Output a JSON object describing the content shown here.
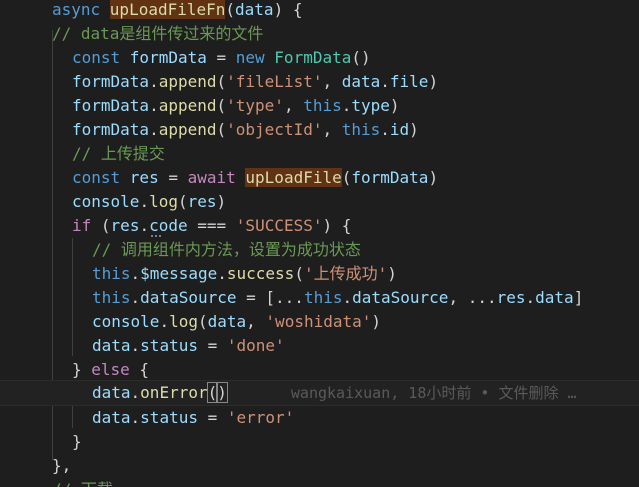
{
  "editor": {
    "lines": [
      [
        {
          "t": "async ",
          "c": "kw"
        },
        {
          "t": "upLoadFileFn",
          "c": "fn hl"
        },
        {
          "t": "(",
          "c": "pun"
        },
        {
          "t": "data",
          "c": "var"
        },
        {
          "t": ") {",
          "c": "pun"
        }
      ],
      [
        {
          "t": "// data是组件传过来的文件",
          "c": "cmt"
        }
      ],
      [
        {
          "t": "const ",
          "c": "kw"
        },
        {
          "t": "formData",
          "c": "var"
        },
        {
          "t": " = ",
          "c": "pun"
        },
        {
          "t": "new ",
          "c": "kw"
        },
        {
          "t": "FormData",
          "c": "cls"
        },
        {
          "t": "()",
          "c": "pun"
        }
      ],
      [
        {
          "t": "formData",
          "c": "var"
        },
        {
          "t": ".",
          "c": "pun"
        },
        {
          "t": "append",
          "c": "fn"
        },
        {
          "t": "(",
          "c": "pun"
        },
        {
          "t": "'fileList'",
          "c": "str"
        },
        {
          "t": ", ",
          "c": "pun"
        },
        {
          "t": "data",
          "c": "var"
        },
        {
          "t": ".",
          "c": "pun"
        },
        {
          "t": "file",
          "c": "var"
        },
        {
          "t": ")",
          "c": "pun"
        }
      ],
      [
        {
          "t": "formData",
          "c": "var"
        },
        {
          "t": ".",
          "c": "pun"
        },
        {
          "t": "append",
          "c": "fn"
        },
        {
          "t": "(",
          "c": "pun"
        },
        {
          "t": "'type'",
          "c": "str"
        },
        {
          "t": ", ",
          "c": "pun"
        },
        {
          "t": "this",
          "c": "kw"
        },
        {
          "t": ".",
          "c": "pun"
        },
        {
          "t": "type",
          "c": "var"
        },
        {
          "t": ")",
          "c": "pun"
        }
      ],
      [
        {
          "t": "formData",
          "c": "var"
        },
        {
          "t": ".",
          "c": "pun"
        },
        {
          "t": "append",
          "c": "fn"
        },
        {
          "t": "(",
          "c": "pun"
        },
        {
          "t": "'objectId'",
          "c": "str"
        },
        {
          "t": ", ",
          "c": "pun"
        },
        {
          "t": "this",
          "c": "kw"
        },
        {
          "t": ".",
          "c": "pun"
        },
        {
          "t": "id",
          "c": "var"
        },
        {
          "t": ")",
          "c": "pun"
        }
      ],
      [
        {
          "t": "// 上传提交",
          "c": "cmt"
        }
      ],
      [
        {
          "t": "const ",
          "c": "kw"
        },
        {
          "t": "res",
          "c": "var"
        },
        {
          "t": " = ",
          "c": "pun"
        },
        {
          "t": "await ",
          "c": "ctl"
        },
        {
          "t": "upLoadFile",
          "c": "fn hl"
        },
        {
          "t": "(",
          "c": "pun"
        },
        {
          "t": "formData",
          "c": "var"
        },
        {
          "t": ")",
          "c": "pun"
        }
      ],
      [
        {
          "t": "console",
          "c": "var"
        },
        {
          "t": ".",
          "c": "pun"
        },
        {
          "t": "log",
          "c": "fn"
        },
        {
          "t": "(",
          "c": "pun"
        },
        {
          "t": "res",
          "c": "var"
        },
        {
          "t": ")",
          "c": "pun"
        }
      ],
      [
        {
          "t": "if ",
          "c": "ctl"
        },
        {
          "t": "(",
          "c": "pun"
        },
        {
          "t": "res",
          "c": "var"
        },
        {
          "t": ".",
          "c": "pun"
        },
        {
          "t": "code",
          "c": "var"
        },
        {
          "t": " === ",
          "c": "pun"
        },
        {
          "t": "'SUCCESS'",
          "c": "str"
        },
        {
          "t": ") {",
          "c": "pun"
        }
      ],
      [
        {
          "t": "// 调用组件内方法，设置为成功状态",
          "c": "cmt"
        }
      ],
      [
        {
          "t": "this",
          "c": "kw"
        },
        {
          "t": ".",
          "c": "pun"
        },
        {
          "t": "$message",
          "c": "var"
        },
        {
          "t": ".",
          "c": "pun"
        },
        {
          "t": "success",
          "c": "fn"
        },
        {
          "t": "(",
          "c": "pun"
        },
        {
          "t": "'上传成功'",
          "c": "str"
        },
        {
          "t": ")",
          "c": "pun"
        }
      ],
      [
        {
          "t": "this",
          "c": "kw"
        },
        {
          "t": ".",
          "c": "pun"
        },
        {
          "t": "dataSource",
          "c": "var"
        },
        {
          "t": " = [...",
          "c": "pun"
        },
        {
          "t": "this",
          "c": "kw"
        },
        {
          "t": ".",
          "c": "pun"
        },
        {
          "t": "dataSource",
          "c": "var"
        },
        {
          "t": ", ...",
          "c": "pun"
        },
        {
          "t": "res",
          "c": "var"
        },
        {
          "t": ".",
          "c": "pun"
        },
        {
          "t": "data",
          "c": "var"
        },
        {
          "t": "]",
          "c": "pun"
        }
      ],
      [
        {
          "t": "console",
          "c": "var"
        },
        {
          "t": ".",
          "c": "pun"
        },
        {
          "t": "log",
          "c": "fn"
        },
        {
          "t": "(",
          "c": "pun"
        },
        {
          "t": "data",
          "c": "var"
        },
        {
          "t": ", ",
          "c": "pun"
        },
        {
          "t": "'woshidata'",
          "c": "str"
        },
        {
          "t": ")",
          "c": "pun"
        }
      ],
      [
        {
          "t": "data",
          "c": "var"
        },
        {
          "t": ".",
          "c": "pun"
        },
        {
          "t": "status",
          "c": "var"
        },
        {
          "t": " = ",
          "c": "pun"
        },
        {
          "t": "'done'",
          "c": "str"
        }
      ],
      [
        {
          "t": "} ",
          "c": "pun"
        },
        {
          "t": "else",
          "c": "ctl"
        },
        {
          "t": " {",
          "c": "pun"
        }
      ],
      [
        {
          "t": "data",
          "c": "var"
        },
        {
          "t": ".",
          "c": "pun"
        },
        {
          "t": "onError",
          "c": "fn"
        },
        {
          "t": "(",
          "c": "pun brk"
        },
        {
          "t": ")",
          "c": "pun brk"
        }
      ],
      [
        {
          "t": "data",
          "c": "var"
        },
        {
          "t": ".",
          "c": "pun"
        },
        {
          "t": "status",
          "c": "var"
        },
        {
          "t": " = ",
          "c": "pun"
        },
        {
          "t": "'error'",
          "c": "str"
        }
      ],
      [
        {
          "t": "}",
          "c": "pun"
        }
      ],
      [
        {
          "t": "},",
          "c": "pun"
        }
      ],
      [
        {
          "t": "// 下载",
          "c": "cmt"
        }
      ]
    ],
    "blame": "wangkaixuan, 18小时前 • 文件删除 …"
  }
}
